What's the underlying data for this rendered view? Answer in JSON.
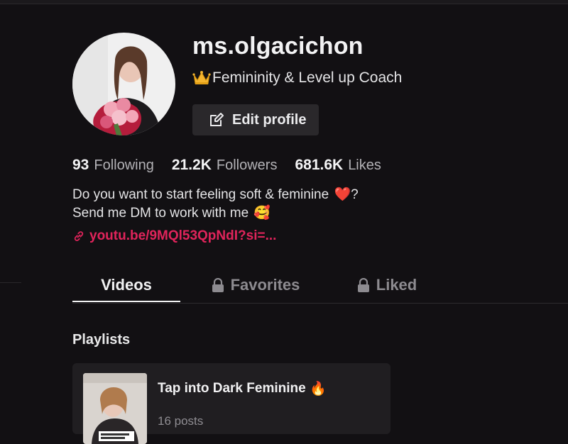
{
  "profile": {
    "username": "ms.olgacichon",
    "nickname": "Femininity & Level up Coach",
    "edit_label": "Edit profile"
  },
  "stats": [
    {
      "value": "93",
      "label": "Following"
    },
    {
      "value": "21.2K",
      "label": "Followers"
    },
    {
      "value": "681.6K",
      "label": "Likes"
    }
  ],
  "bio": {
    "line1": "Do you want to start feeling soft & feminine",
    "line1_emoji": "❤️",
    "line1_end": "?",
    "line2": "Send me DM to work with me",
    "line2_emoji": "🥰"
  },
  "link": {
    "text": "youtu.be/9MQl53QpNdI?si=..."
  },
  "tabs": [
    {
      "label": "Videos",
      "locked": false,
      "active": true
    },
    {
      "label": "Favorites",
      "locked": true,
      "active": false
    },
    {
      "label": "Liked",
      "locked": true,
      "active": false
    }
  ],
  "playlists": {
    "title": "Playlists",
    "items": [
      {
        "title": "Tap into Dark Feminine",
        "emoji": "🔥",
        "count": "16 posts"
      }
    ]
  },
  "colors": {
    "background": "#121013",
    "link": "#e0245b",
    "button": "#2a282b",
    "muted": "#8d8b90"
  },
  "icons": {
    "nickname": "crown-icon",
    "edit": "edit-icon",
    "link": "link-icon",
    "tab_lock": "lock-icon",
    "title_emoji": "fire-emoji"
  }
}
